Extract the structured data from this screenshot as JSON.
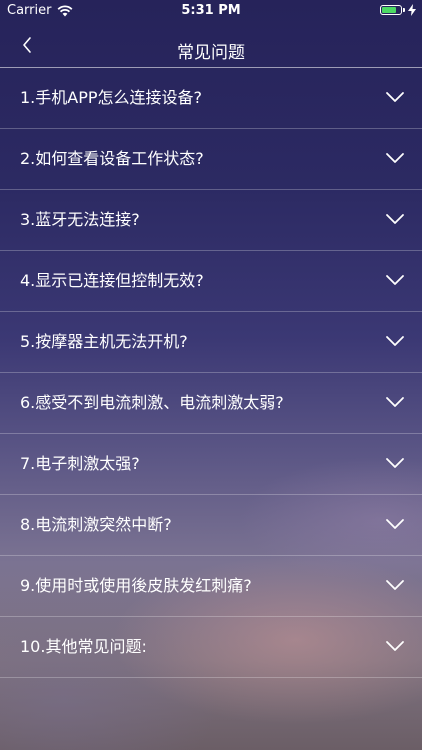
{
  "status_bar": {
    "carrier": "Carrier",
    "time": "5:31 PM",
    "battery_level": 0.8,
    "battery_color": "#4cd964"
  },
  "nav": {
    "title": "常见问题",
    "back_icon": "chevron-left-icon"
  },
  "faq": {
    "items": [
      {
        "question": "1.手机APP怎么连接设备?"
      },
      {
        "question": "2.如何查看设备工作状态?"
      },
      {
        "question": "3.蓝牙无法连接?"
      },
      {
        "question": "4.显示已连接但控制无效?"
      },
      {
        "question": "5.按摩器主机无法开机?"
      },
      {
        "question": "6.感受不到电流刺激、电流刺激太弱?"
      },
      {
        "question": "7.电子刺激太强?"
      },
      {
        "question": "8.电流刺激突然中断?"
      },
      {
        "question": "9.使用时或使用後皮肤发红刺痛?"
      },
      {
        "question": "10.其他常见问题:"
      }
    ],
    "expand_icon": "chevron-down-icon"
  }
}
